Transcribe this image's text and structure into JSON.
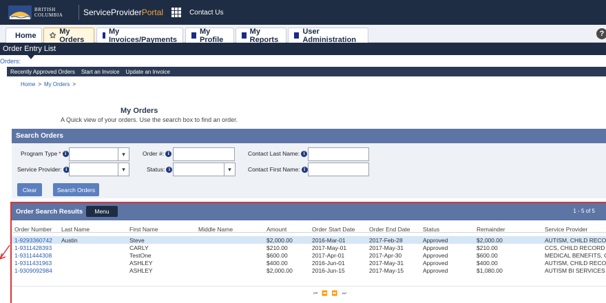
{
  "header": {
    "logo_line1": "BRITISH",
    "logo_line2": "COLUMBIA",
    "portal_name_main": "ServiceProvider",
    "portal_name_accent": "Portal",
    "contact_label": "Contact Us"
  },
  "tabs": [
    {
      "label": "Home",
      "icon": "square-icon"
    },
    {
      "label": "My Orders",
      "icon": "star-icon",
      "active": true
    },
    {
      "label": "My Invoices/Payments",
      "icon": "square-icon"
    },
    {
      "label": "My Profile",
      "icon": "square-icon"
    },
    {
      "label": "My Reports",
      "icon": "square-icon"
    },
    {
      "label": "User Administration",
      "icon": "square-icon"
    }
  ],
  "help_label": "?",
  "order_entry": {
    "title": "Order Entry List",
    "orders_link": "Orders:"
  },
  "subnav": [
    "Recently Approved Orders",
    "Start an Invoice",
    "Update an Invoice"
  ],
  "breadcrumb": {
    "home": "Home",
    "sep": ">",
    "current": "My Orders",
    "trail": ">"
  },
  "page": {
    "title": "My Orders",
    "subtitle": "A Quick view of your orders. Use the search box to find an order."
  },
  "search": {
    "heading": "Search Orders",
    "program_type_label": "Program Type",
    "required_mark": "*",
    "service_provider_label": "Service Provider:",
    "order_no_label": "Order #:",
    "status_label": "Status:",
    "contact_last_label": "Contact Last Name:",
    "contact_first_label": "Contact First Name:",
    "chevron": "▾",
    "clear_button": "Clear",
    "search_button": "Search Orders"
  },
  "results": {
    "heading": "Order Search Results",
    "menu_button": "Menu",
    "count": "1 - 5 of 5",
    "columns": [
      "Order Number",
      "Last Name",
      "First Name",
      "Middle Name",
      "Amount",
      "Order Start Date",
      "Order End Date",
      "Status",
      "Remainder",
      "Service Provider"
    ],
    "rows": [
      [
        "1-9293360742",
        "Austin",
        "Steve",
        "",
        "$2,000.00",
        "2016-Mar-01",
        "2017-Feb-28",
        "Approved",
        "$2,000.00",
        "AUTISM, CHILD RECORI"
      ],
      [
        "1-9311428393",
        "",
        "CARLY",
        "",
        "$210.00",
        "2017-May-01",
        "2017-May-31",
        "Approved",
        "$210.00",
        "CCS, CHILD RECORD"
      ],
      [
        "1-9311444308",
        "",
        "TestOne",
        "",
        "$600.00",
        "2017-Apr-01",
        "2017-Apr-30",
        "Approved",
        "$600.00",
        "MEDICAL BENEFITS, CH"
      ],
      [
        "1-9311431963",
        "",
        "ASHLEY",
        "",
        "$400.00",
        "2016-Jun-01",
        "2017-May-31",
        "Approved",
        "$400.00",
        "AUTISM, CHILD RECORI"
      ],
      [
        "1-9309092984",
        "",
        "ASHLEY",
        "",
        "$2,000.00",
        "2016-Jun-15",
        "2017-May-15",
        "Approved",
        "$1,080.00",
        "AUTISM BI SERVICES"
      ]
    ],
    "pager": "⏮ ⏪ ⏩ ⏭"
  },
  "colors": {
    "header_bg": "#1f2d44",
    "panel_head": "#5d75a5",
    "accent_orange": "#f3a33a",
    "link_blue": "#2a5db0",
    "highlight_red": "#d33"
  }
}
